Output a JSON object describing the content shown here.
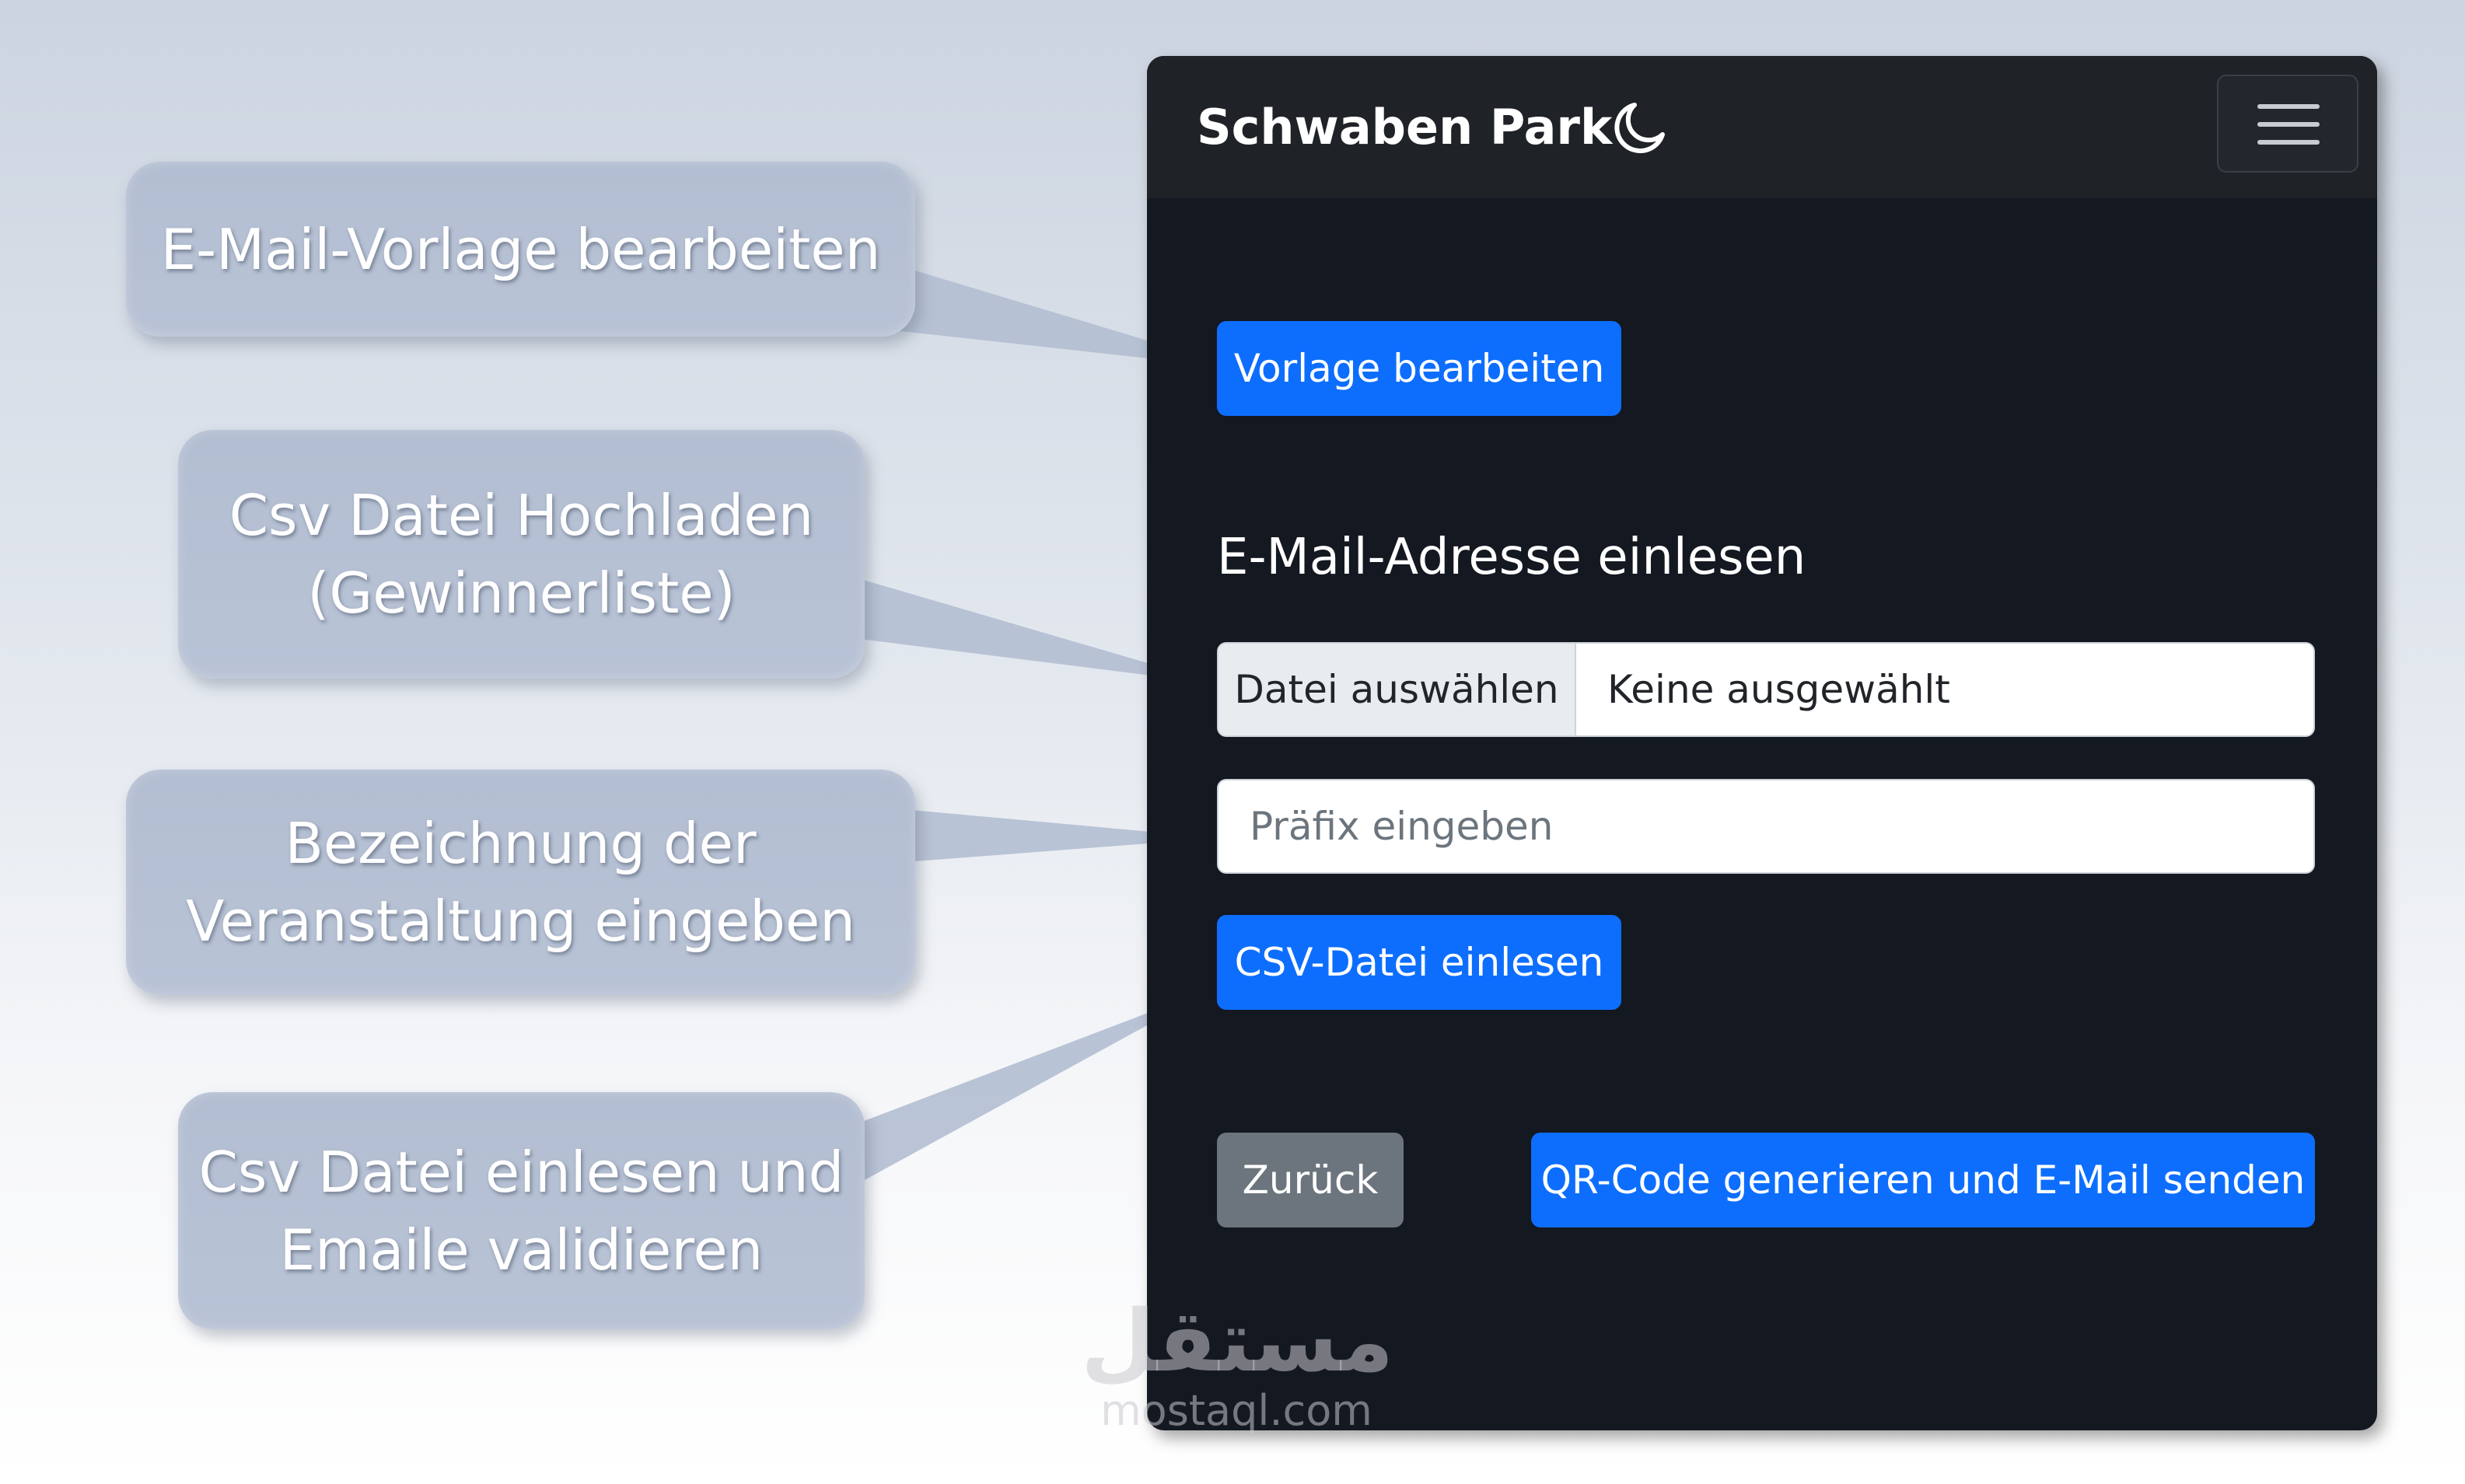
{
  "callouts": [
    {
      "text": "E-Mail-Vorlage bearbeiten"
    },
    {
      "text": "Csv Datei Hochladen\n(Gewinnerliste)"
    },
    {
      "text": "Bezeichnung der\nVeranstaltung eingeben"
    },
    {
      "text": "Csv Datei einlesen und\nEmaile validieren"
    }
  ],
  "navbar": {
    "brand": "Schwaben Park",
    "theme_icon": "moon-icon",
    "menu_icon": "hamburger-menu-icon"
  },
  "main": {
    "edit_template_label": "Vorlage bearbeiten",
    "section_title": "E-Mail-Adresse einlesen",
    "file_input": {
      "button_label": "Datei auswählen",
      "status": "Keine ausgewählt"
    },
    "prefix_input": {
      "placeholder": "Präfix eingeben",
      "value": ""
    },
    "read_csv_label": "CSV-Datei einlesen",
    "back_label": "Zurück",
    "generate_label": "QR-Code generieren und E-Mail senden"
  },
  "watermark": {
    "arabic": "مستقل",
    "latin": "mostaql.com"
  },
  "colors": {
    "primary": "#0d6efd",
    "secondary": "#6c757d",
    "navbar_bg": "#1f2227",
    "body_bg": "#141821",
    "callout_bg": "#b6c0d4"
  }
}
